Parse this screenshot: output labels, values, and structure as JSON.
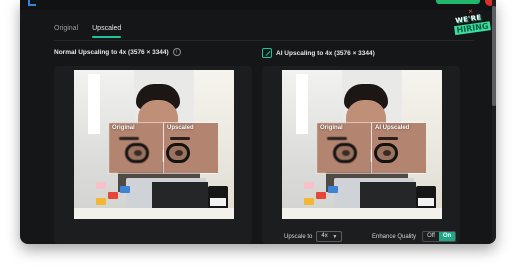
{
  "tabs": [
    {
      "label": "Original",
      "active": false
    },
    {
      "label": "Upscaled",
      "active": true
    }
  ],
  "left_panel": {
    "title": "Normal Upscaling to 4x (3576 × 3344)",
    "info_icon": "info-icon",
    "compare": {
      "left_label": "Original",
      "right_label": "Upscaled"
    }
  },
  "right_panel": {
    "title": "AI Upscaling to 4x (3576 × 3344)",
    "title_icon": "ai-upscale-icon",
    "compare": {
      "left_label": "Original",
      "right_label": "AI Upscaled"
    }
  },
  "controls": {
    "upscale_label": "Upscale to",
    "upscale_value": "4x",
    "enhance_label": "Enhance Quality",
    "off_label": "Off",
    "on_label": "On",
    "enhance_state": "On"
  },
  "badge": {
    "we_text": "WE'RE",
    "hiring_text": "HIRING",
    "close_glyph": "×"
  },
  "colors": {
    "accent": "#1fc39a",
    "toggle_on": "#1fa888",
    "background": "#151617",
    "panel": "#1c1d1f"
  }
}
